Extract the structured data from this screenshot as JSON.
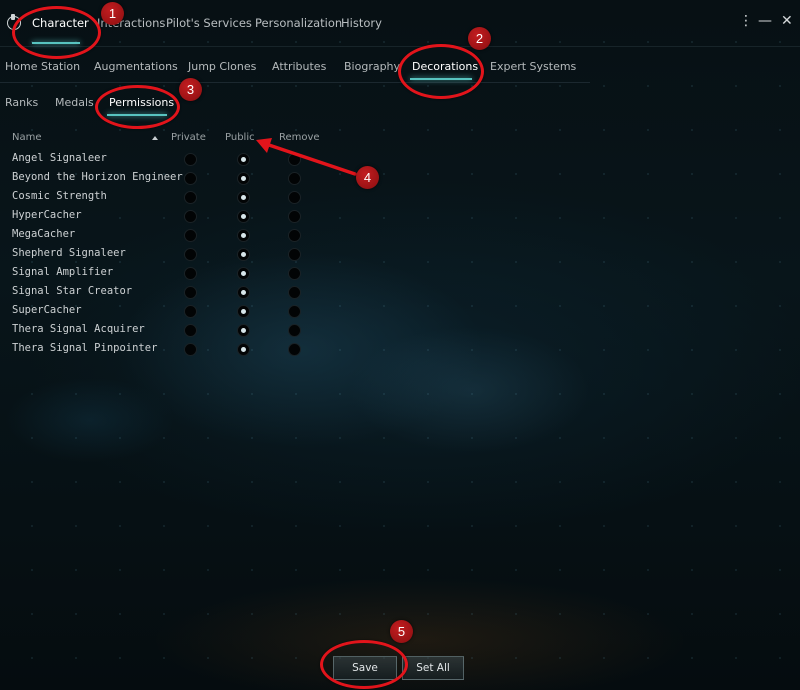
{
  "top_tabs": [
    {
      "label": "Character",
      "active": true
    },
    {
      "label": "Interactions",
      "active": false
    },
    {
      "label": "Pilot's Services",
      "active": false
    },
    {
      "label": "Personalization",
      "active": false
    },
    {
      "label": "History",
      "active": false
    }
  ],
  "window_controls": {
    "more": "⋮",
    "minimize": "—",
    "close": "✕"
  },
  "sub_tabs": [
    {
      "label": "Home Station",
      "active": false
    },
    {
      "label": "Augmentations",
      "active": false
    },
    {
      "label": "Jump Clones",
      "active": false
    },
    {
      "label": "Attributes",
      "active": false
    },
    {
      "label": "Biography",
      "active": false
    },
    {
      "label": "Decorations",
      "active": true
    },
    {
      "label": "Expert Systems",
      "active": false
    }
  ],
  "decoration_tabs": [
    {
      "label": "Ranks",
      "active": false
    },
    {
      "label": "Medals",
      "active": false
    },
    {
      "label": "Permissions",
      "active": true
    }
  ],
  "table": {
    "headers": {
      "name": "Name",
      "private": "Private",
      "public": "Public",
      "remove": "Remove"
    },
    "rows": [
      {
        "name": "Angel Signaleer",
        "selected": "public"
      },
      {
        "name": "Beyond the Horizon Engineer",
        "selected": "public"
      },
      {
        "name": "Cosmic Strength",
        "selected": "public"
      },
      {
        "name": "HyperCacher",
        "selected": "public"
      },
      {
        "name": "MegaCacher",
        "selected": "public"
      },
      {
        "name": "Shepherd Signaleer",
        "selected": "public"
      },
      {
        "name": "Signal Amplifier",
        "selected": "public"
      },
      {
        "name": "Signal Star Creator",
        "selected": "public"
      },
      {
        "name": "SuperCacher",
        "selected": "public"
      },
      {
        "name": "Thera Signal Acquirer",
        "selected": "public"
      },
      {
        "name": "Thera Signal Pinpointer",
        "selected": "public"
      }
    ]
  },
  "buttons": {
    "save": "Save",
    "set_all": "Set All"
  },
  "annotations": [
    "1",
    "2",
    "3",
    "4",
    "5"
  ],
  "colors": {
    "accent": "#58c4c0",
    "annotation": "#e2141b"
  }
}
